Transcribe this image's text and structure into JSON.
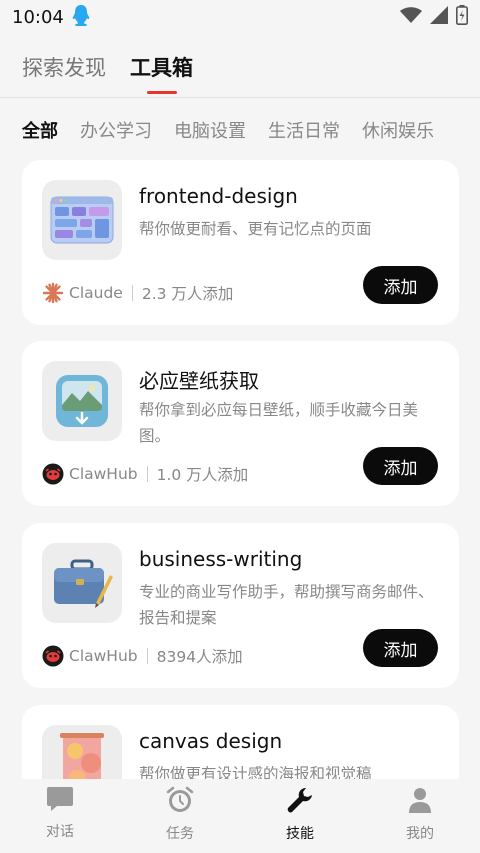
{
  "status": {
    "time": "10:04"
  },
  "top_tabs": [
    {
      "label": "探索发现",
      "active": false
    },
    {
      "label": "工具箱",
      "active": true
    }
  ],
  "categories": [
    {
      "label": "全部",
      "active": true
    },
    {
      "label": "办公学习",
      "active": false
    },
    {
      "label": "电脑设置",
      "active": false
    },
    {
      "label": "生活日常",
      "active": false
    },
    {
      "label": "休闲娱乐",
      "active": false
    }
  ],
  "cards": [
    {
      "title": "frontend-design",
      "desc": "帮你做更耐看、更有记忆点的页面",
      "source": "Claude",
      "count": "2.3 万人添加",
      "button": "添加"
    },
    {
      "title": "必应壁纸获取",
      "desc": "帮你拿到必应每日壁纸，顺手收藏今日美图。",
      "source": "ClawHub",
      "count": "1.0 万人添加",
      "button": "添加"
    },
    {
      "title": "business-writing",
      "desc": "专业的商业写作助手，帮助撰写商务邮件、报告和提案",
      "source": "ClawHub",
      "count": "8394人添加",
      "button": "添加"
    },
    {
      "title": "canvas design",
      "desc": "帮你做更有设计感的海报和视觉稿",
      "source": "",
      "count": "",
      "button": ""
    }
  ],
  "bottom_nav": [
    {
      "label": "对话",
      "icon": "chat-icon",
      "active": false
    },
    {
      "label": "任务",
      "icon": "alarm-clock-icon",
      "active": false
    },
    {
      "label": "技能",
      "icon": "wrench-icon",
      "active": true
    },
    {
      "label": "我的",
      "icon": "person-icon",
      "active": false
    }
  ],
  "colors": {
    "accent": "#e8342a",
    "button": "#0b0b0b",
    "background": "#f5f5f5"
  }
}
